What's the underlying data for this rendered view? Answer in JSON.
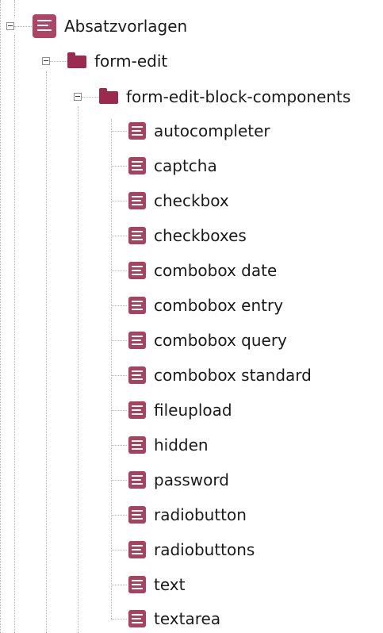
{
  "tree": {
    "root": {
      "label": "Absatzvorlagen",
      "icon": "document-icon"
    },
    "folder1": {
      "label": "form-edit",
      "icon": "folder-icon"
    },
    "folder2": {
      "label": "form-edit-block-components",
      "icon": "folder-icon"
    },
    "items": [
      {
        "label": "autocompleter"
      },
      {
        "label": "captcha"
      },
      {
        "label": "checkbox"
      },
      {
        "label": "checkboxes"
      },
      {
        "label": "combobox date"
      },
      {
        "label": "combobox entry"
      },
      {
        "label": "combobox query"
      },
      {
        "label": "combobox standard"
      },
      {
        "label": "fileupload"
      },
      {
        "label": "hidden"
      },
      {
        "label": "password"
      },
      {
        "label": "radiobutton"
      },
      {
        "label": "radiobuttons"
      },
      {
        "label": "text"
      },
      {
        "label": "textarea"
      }
    ]
  },
  "colors": {
    "icon_primary": "#a8425f",
    "folder": "#9b2a4e",
    "tree_lines": "#b5b5b5"
  }
}
